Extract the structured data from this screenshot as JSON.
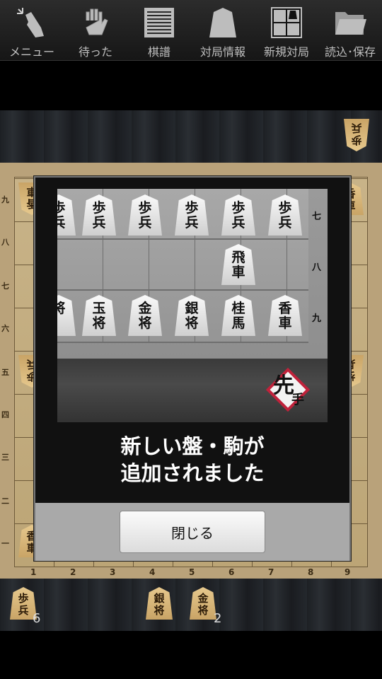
{
  "toolbar": {
    "items": [
      {
        "label": "メニュー",
        "icon": "tap-hand-icon"
      },
      {
        "label": "待った",
        "icon": "palm-hand-icon"
      },
      {
        "label": "棋譜",
        "icon": "lines-icon"
      },
      {
        "label": "対局情報",
        "icon": "piece-silhouette-icon"
      },
      {
        "label": "新規対局",
        "icon": "grid-icon"
      },
      {
        "label": "読込･保存",
        "icon": "folder-icon"
      }
    ]
  },
  "board": {
    "ranks": [
      "九",
      "八",
      "七",
      "六",
      "五",
      "四",
      "三",
      "二",
      "一"
    ],
    "files": [
      "1",
      "2",
      "3",
      "4",
      "5",
      "6",
      "7",
      "8",
      "9"
    ],
    "visible_pieces": [
      {
        "top": "香",
        "bottom": "車"
      },
      {
        "top": "歩",
        "bottom": "兵"
      },
      {
        "top": "香",
        "bottom": "車"
      },
      {
        "top": "香",
        "bottom": "車"
      },
      {
        "top": "歩",
        "bottom": "兵"
      }
    ]
  },
  "opponent_hand": {
    "piece": {
      "top": "歩",
      "bottom": "兵"
    }
  },
  "player_hand": {
    "pieces": [
      {
        "top": "歩",
        "bottom": "兵",
        "count": "6"
      },
      {
        "top": "銀",
        "bottom": "将",
        "count": ""
      },
      {
        "top": "金",
        "bottom": "将",
        "count": "2"
      }
    ]
  },
  "dialog": {
    "preview": {
      "ranks": [
        "七",
        "八",
        "九"
      ],
      "row7": [
        {
          "top": "歩",
          "bottom": "兵"
        },
        {
          "top": "歩",
          "bottom": "兵"
        },
        {
          "top": "歩",
          "bottom": "兵"
        },
        {
          "top": "歩",
          "bottom": "兵"
        },
        {
          "top": "歩",
          "bottom": "兵"
        },
        {
          "top": "歩",
          "bottom": "兵"
        }
      ],
      "row8": {
        "top": "飛",
        "bottom": "車"
      },
      "row9": [
        {
          "top": "",
          "bottom": "将"
        },
        {
          "top": "玉",
          "bottom": "将"
        },
        {
          "top": "金",
          "bottom": "将"
        },
        {
          "top": "銀",
          "bottom": "将"
        },
        {
          "top": "桂",
          "bottom": "馬"
        },
        {
          "top": "香",
          "bottom": "車"
        }
      ],
      "badge_main": "先",
      "badge_sub": "手"
    },
    "message_line1": "新しい盤・駒が",
    "message_line2": "追加されました",
    "close_label": "閉じる"
  },
  "colors": {
    "board": "#c2aa7d",
    "dialog_bg": "#111111",
    "footer": "#a9a9a9",
    "badge": "#c0223b"
  }
}
